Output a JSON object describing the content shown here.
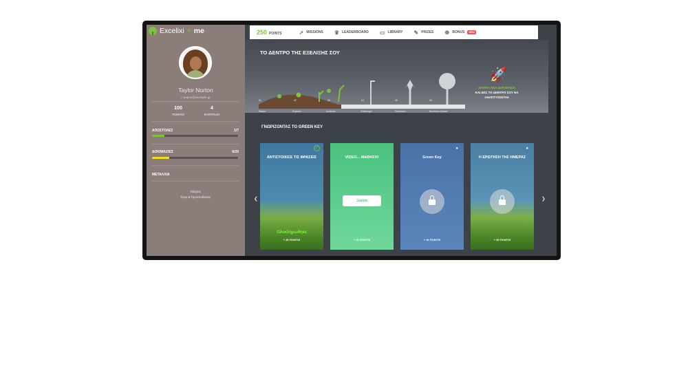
{
  "app": {
    "logo_text": "Excelixi",
    "logo_plus": "+",
    "logo_me": "me"
  },
  "user": {
    "name": "Taylor Norton",
    "email": "c.papas@example.gr",
    "points": "100",
    "points_label": "ΠΟΝΤΟΙ",
    "rank": "4",
    "rank_label": "ΚΑΤΑΤΑΞΗ"
  },
  "progress": [
    {
      "label": "ΑΠΟΣΤΟΛΕΣ",
      "value_text": "1/7",
      "fraction": 0.14,
      "color": "#7ec242"
    },
    {
      "label": "ΔΟΚΙΜΑΣΙΕΣ",
      "value_text": "6/20",
      "fraction": 0.2,
      "color": "#f0e01c"
    }
  ],
  "sidebar": {
    "medals": "ΜΕΤΑΛΛΙΑ",
    "links": [
      "Οδηγίες",
      "Όροι & Προϋποθέσεις"
    ]
  },
  "topnav": {
    "points_value": "250",
    "points_label": "POINTS",
    "items": [
      {
        "label": "MISSIONS",
        "icon": "rocket-icon"
      },
      {
        "label": "LEADERBOARD",
        "icon": "leaderboard-icon"
      },
      {
        "label": "LIBRARY",
        "icon": "library-icon"
      },
      {
        "label": "PRIZES",
        "icon": "prizes-icon"
      },
      {
        "label": "BONUS",
        "icon": "bonus-icon"
      }
    ],
    "bonus_badge": "NEW"
  },
  "tree": {
    "title": "ΤΟ ΔΕΝΤΡΟ ΤΗΣ ΕΞΕΛΙΞΗΣ ΣΟΥ",
    "stage_numbers": [
      "01",
      "02",
      "03",
      "04",
      "05",
      "06"
    ],
    "stage_names": [
      "Starter",
      "Explorer",
      "Achiever",
      "Challenger",
      "Developer",
      "Business Grower"
    ],
    "cta_line1": "ΞΕΚΙΝΑ ΝΕΑ ΔΟΚΙΜΑΣΙΑ",
    "cta_line2": "ΚΑΙ ΔΕΣ ΤΟ ΔΕΝΤΡΟ ΣΟΥ ΝΑ",
    "cta_line3": "ΑΝΑΠΤΥΣΣΕΤΑΙ!"
  },
  "section": {
    "title": "ΓΝΩΡΙΖΟΝΤΑΣ ΤΟ GREEN KEY"
  },
  "cards": [
    {
      "title": "ΑΝΤΙΣΤΟΙΧΙΣΕ ΤΙΣ ΦΡΑΣΕΙΣ",
      "status": "Ολοκληρώθηκε",
      "points": "+ 40 ΠΟΝΤΟΙ",
      "bg_top": "#3f78a0",
      "bg_bottom": "#5a9bbd"
    },
    {
      "title": "VIDEO... ΜΑΘΗΣΗ!",
      "button": "Ξεκίνα",
      "points": "+ 30 ΠΟΝΤΟΙ",
      "bg_top": "#49c27e",
      "bg_bottom": "#6fd89a"
    },
    {
      "title": "Green Key",
      "points": "+ 40 ΠΟΝΤΟΙ",
      "bg_top": "#4a72a8",
      "bg_bottom": "#5a85bb"
    },
    {
      "title": "Η ΕΡΩΤΗΣΗ ΤΗΣ ΗΜΕΡΑΣ",
      "points": "+ 30 ΠΟΝΤΟΙ",
      "bg_top": "#4b7fa4",
      "bg_bottom": "#68a5c8"
    }
  ],
  "colors": {
    "accent_green": "#7ec242",
    "sidebar_bg": "#8b7d7a",
    "main_bg": "#3d4148"
  }
}
